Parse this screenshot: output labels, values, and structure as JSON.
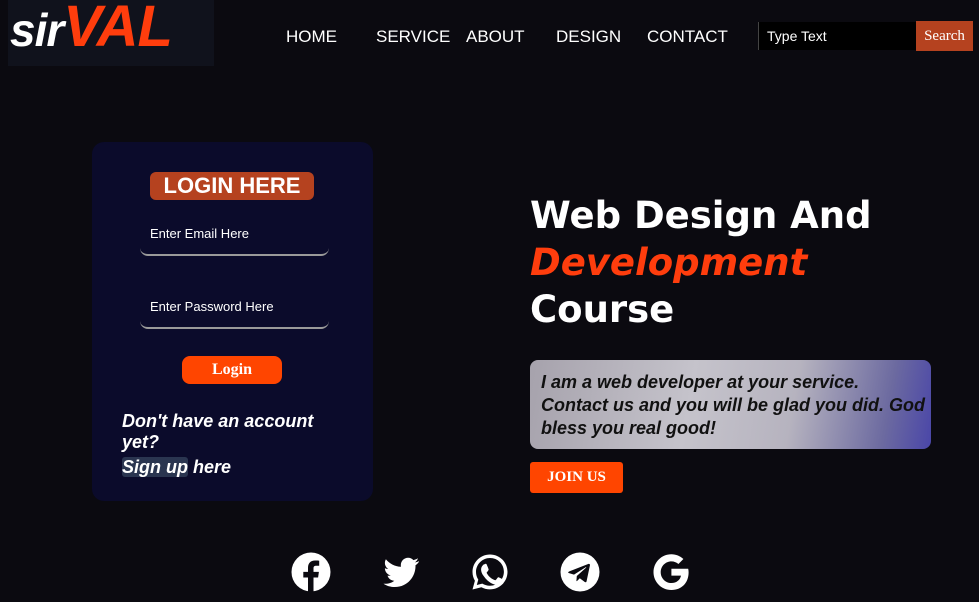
{
  "header": {
    "logo": {
      "part1": "sir",
      "part2": "VAL"
    },
    "nav": [
      "HOME",
      "SERVICE",
      "ABOUT",
      "DESIGN",
      "CONTACT"
    ],
    "search": {
      "placeholder": "Type Text",
      "button_label": "Search"
    }
  },
  "login": {
    "title": "LOGIN HERE",
    "email_placeholder": "Enter Email Here",
    "password_placeholder": "Enter Password Here",
    "button_label": "Login",
    "no_account_text": "Don't have an account yet?",
    "signup_link": "Sign up",
    "signup_suffix": " here"
  },
  "hero": {
    "line1": "Web Design And",
    "accent": "Development",
    "line3": "Course",
    "quote": "I am a web developer at your service. Contact us and you will be glad you did. God bless you real good!",
    "join_label": "JOIN US"
  },
  "social": {
    "icons": [
      "facebook-icon",
      "twitter-icon",
      "whatsapp-icon",
      "telegram-icon",
      "google-icon"
    ]
  },
  "colors": {
    "background": "#0b0a10",
    "accent": "#ff4500",
    "brand_red": "#b5421f",
    "card": "#0b0b2b"
  }
}
